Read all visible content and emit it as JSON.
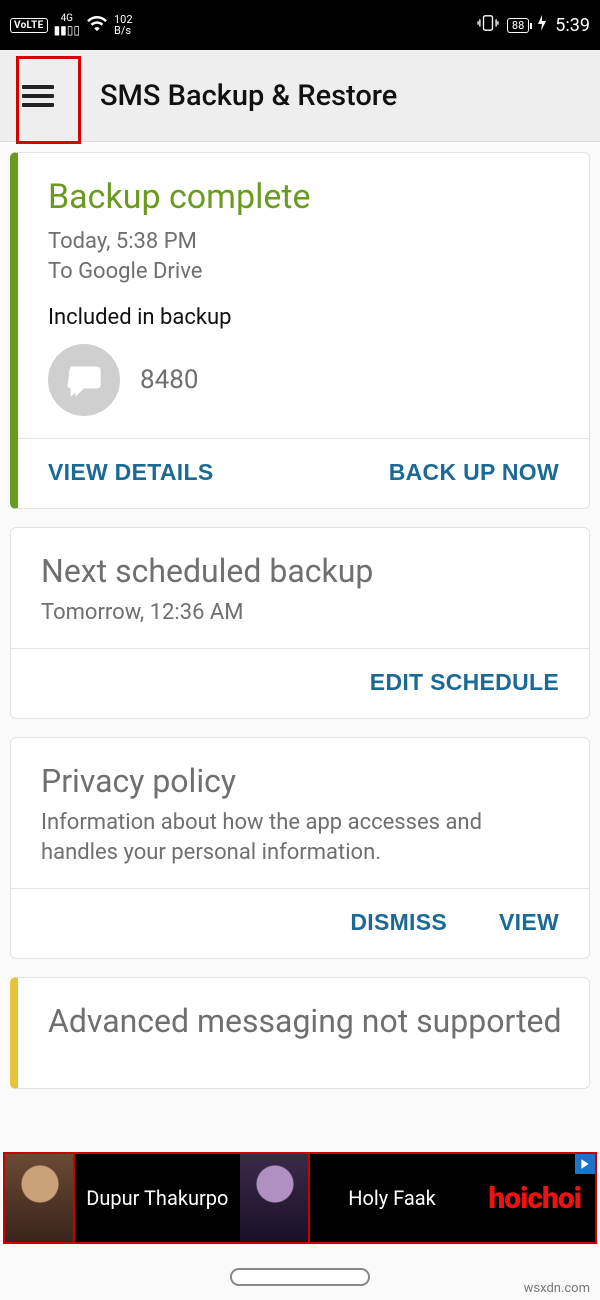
{
  "status": {
    "volte": "VoLTE",
    "net4g_top": "4G",
    "net4g_bottom": "↑↓",
    "speed_top": "102",
    "speed_bottom": "B/s",
    "battery": "88",
    "clock": "5:39"
  },
  "appbar": {
    "title": "SMS Backup & Restore"
  },
  "backup": {
    "heading": "Backup complete",
    "time": "Today, 5:38 PM",
    "dest": "To Google Drive",
    "included_label": "Included in backup",
    "sms_count": "8480",
    "view_details": "VIEW DETAILS",
    "back_up_now": "BACK UP NOW"
  },
  "schedule": {
    "heading": "Next scheduled backup",
    "when": "Tomorrow, 12:36 AM",
    "edit": "EDIT SCHEDULE"
  },
  "privacy": {
    "heading": "Privacy policy",
    "body": "Information about how the app accesses and handles your personal information.",
    "dismiss": "DISMISS",
    "view": "VIEW"
  },
  "advanced": {
    "heading": "Advanced messaging not supported"
  },
  "ad": {
    "title1": "Dupur Thakurpo",
    "title2": "Holy Faak",
    "brand": "hoichoi"
  },
  "watermark": "wsxdn.com"
}
